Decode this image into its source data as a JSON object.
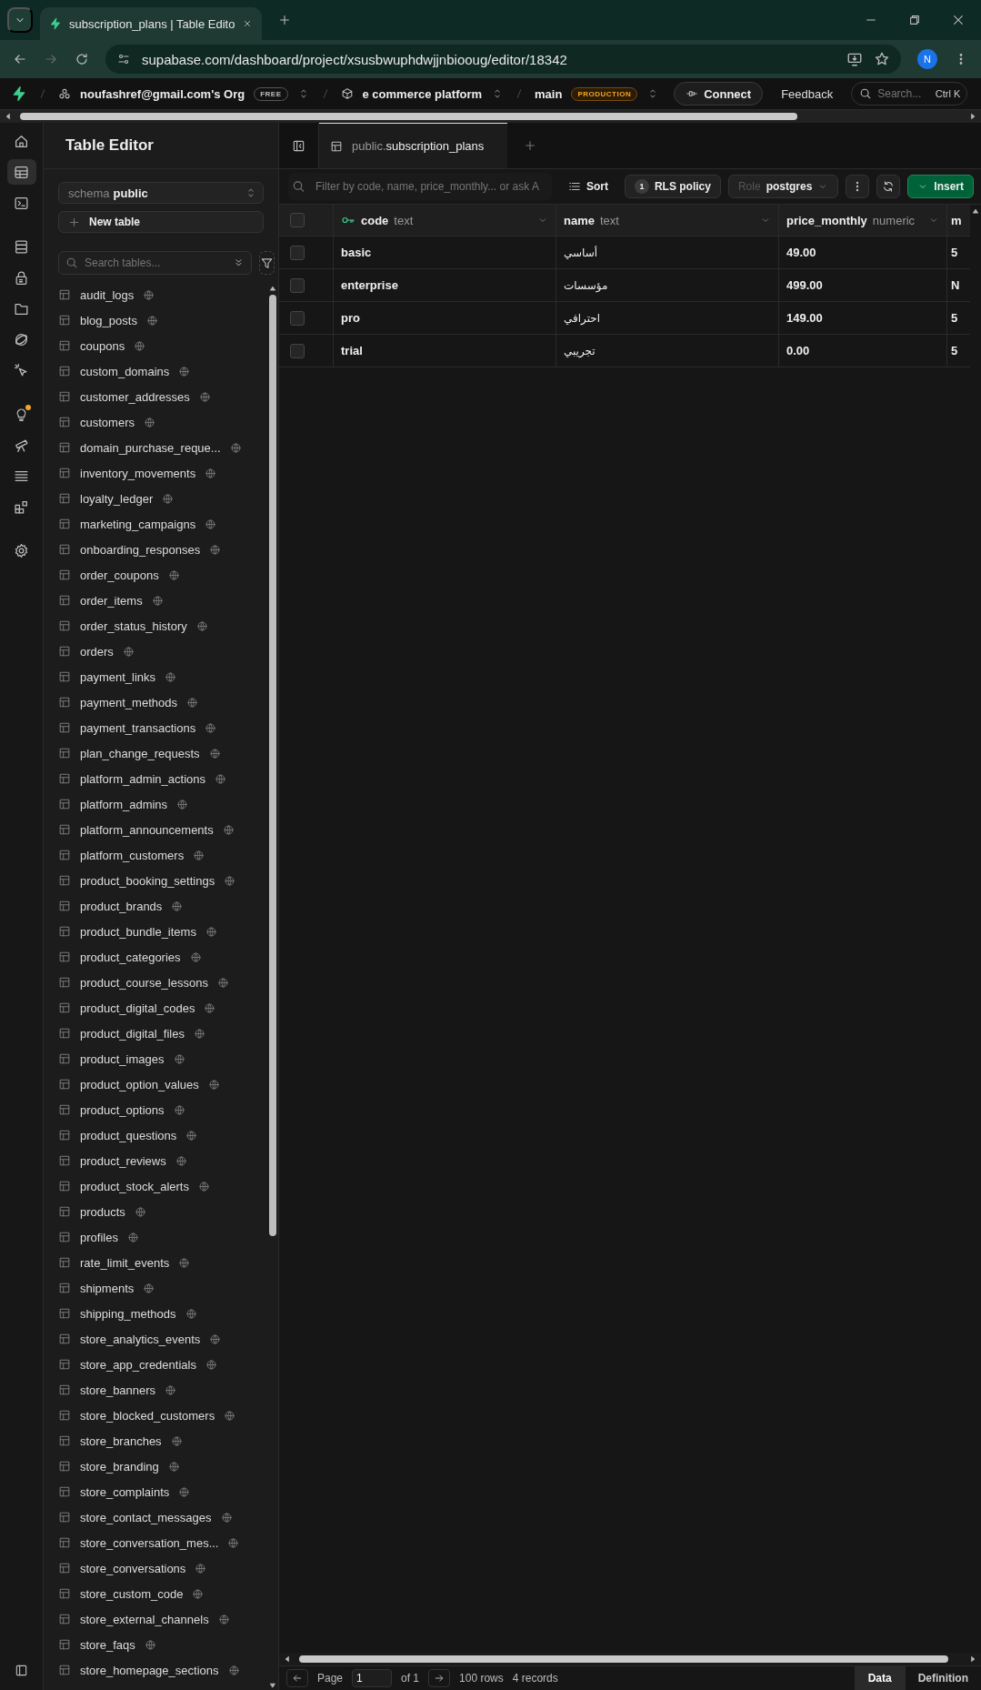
{
  "browser": {
    "tab_title": "subscription_plans | Table Edito",
    "url": "supabase.com/dashboard/project/xsusbwuphdwjjnbiooug/editor/18342",
    "avatar": "N"
  },
  "topnav": {
    "org": "noufashref@gmail.com's Org",
    "org_badge": "FREE",
    "project": "e commerce platform",
    "branch": "main",
    "branch_badge": "PRODUCTION",
    "connect": "Connect",
    "feedback": "Feedback",
    "search_placeholder": "Search...",
    "shortcut": "Ctrl K"
  },
  "rail": [
    {
      "kind": "home",
      "selected": false,
      "notification": false
    },
    {
      "kind": "table",
      "selected": true,
      "notification": false
    },
    {
      "kind": "terminal",
      "selected": false,
      "notification": false
    },
    {
      "kind": "database",
      "selected": false,
      "notification": false
    },
    {
      "kind": "lock",
      "selected": false,
      "notification": false
    },
    {
      "kind": "folder",
      "selected": false,
      "notification": false
    },
    {
      "kind": "orbit",
      "selected": false,
      "notification": false
    },
    {
      "kind": "cursor",
      "selected": false,
      "notification": false
    },
    {
      "kind": "bulb",
      "selected": false,
      "notification": true
    },
    {
      "kind": "telescope",
      "selected": false,
      "notification": false
    },
    {
      "kind": "list",
      "selected": false,
      "notification": false
    },
    {
      "kind": "blocks",
      "selected": false,
      "notification": false
    },
    {
      "kind": "gear",
      "selected": false,
      "notification": false
    }
  ],
  "sidebar": {
    "title": "Table Editor",
    "schema_label": "schema",
    "schema_value": "public",
    "new_table": "New table",
    "search_placeholder": "Search tables...",
    "tables": [
      "audit_logs",
      "blog_posts",
      "coupons",
      "custom_domains",
      "customer_addresses",
      "customers",
      "domain_purchase_reque...",
      "inventory_movements",
      "loyalty_ledger",
      "marketing_campaigns",
      "onboarding_responses",
      "order_coupons",
      "order_items",
      "order_status_history",
      "orders",
      "payment_links",
      "payment_methods",
      "payment_transactions",
      "plan_change_requests",
      "platform_admin_actions",
      "platform_admins",
      "platform_announcements",
      "platform_customers",
      "product_booking_settings",
      "product_brands",
      "product_bundle_items",
      "product_categories",
      "product_course_lessons",
      "product_digital_codes",
      "product_digital_files",
      "product_images",
      "product_option_values",
      "product_options",
      "product_questions",
      "product_reviews",
      "product_stock_alerts",
      "products",
      "profiles",
      "rate_limit_events",
      "shipments",
      "shipping_methods",
      "store_analytics_events",
      "store_app_credentials",
      "store_banners",
      "store_blocked_customers",
      "store_branches",
      "store_branding",
      "store_complaints",
      "store_contact_messages",
      "store_conversation_mes...",
      "store_conversations",
      "store_custom_code",
      "store_external_channels",
      "store_faqs",
      "store_homepage_sections"
    ]
  },
  "editor": {
    "tab_prefix": "public.",
    "tab_name": "subscription_plans",
    "filter_placeholder": "Filter by code, name, price_monthly... or ask A",
    "sort": "Sort",
    "rls_count": "1",
    "rls": "RLS policy",
    "role_label": "Role",
    "role": "postgres",
    "insert": "Insert"
  },
  "grid": {
    "columns": [
      {
        "name": "code",
        "type": "text",
        "primary": true
      },
      {
        "name": "name",
        "type": "text",
        "primary": false
      },
      {
        "name": "price_monthly",
        "type": "numeric",
        "primary": false
      },
      {
        "name": "m"
      }
    ],
    "all_checked": false,
    "rows": [
      {
        "checked": false,
        "cells": [
          "basic",
          "أساسي",
          "49.00",
          "5"
        ]
      },
      {
        "checked": false,
        "cells": [
          "enterprise",
          "مؤسسات",
          "499.00",
          "N"
        ]
      },
      {
        "checked": false,
        "cells": [
          "pro",
          "احترافي",
          "149.00",
          "5"
        ]
      },
      {
        "checked": false,
        "cells": [
          "trial",
          "تجريبي",
          "0.00",
          "5"
        ]
      }
    ]
  },
  "footer": {
    "page_label": "Page",
    "page": "1",
    "page_of": "of 1",
    "rows": "100 rows",
    "records": "4 records",
    "tabs": [
      {
        "label": "Data",
        "selected": true
      },
      {
        "label": "Definition",
        "selected": false
      }
    ]
  }
}
